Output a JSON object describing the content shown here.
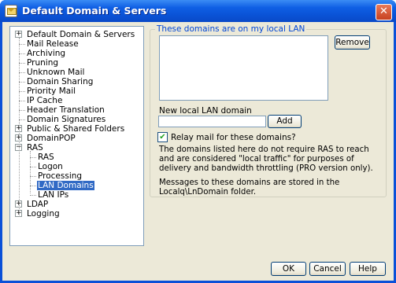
{
  "window": {
    "title": "Default Domain & Servers",
    "close_glyph": "✕"
  },
  "tree": {
    "items": [
      {
        "label": "Default Domain & Servers",
        "expander": "+"
      },
      {
        "label": "Mail Release"
      },
      {
        "label": "Archiving"
      },
      {
        "label": "Pruning"
      },
      {
        "label": "Unknown Mail"
      },
      {
        "label": "Domain Sharing"
      },
      {
        "label": "Priority Mail"
      },
      {
        "label": "IP Cache"
      },
      {
        "label": "Header Translation"
      },
      {
        "label": "Domain Signatures"
      },
      {
        "label": "Public & Shared Folders",
        "expander": "+"
      },
      {
        "label": "DomainPOP",
        "expander": "+"
      },
      {
        "label": "RAS",
        "expander": "−"
      },
      {
        "label": "RAS"
      },
      {
        "label": "Logon"
      },
      {
        "label": "Processing"
      },
      {
        "label": "LAN Domains",
        "selected": true
      },
      {
        "label": "LAN IPs"
      },
      {
        "label": "LDAP",
        "expander": "+"
      },
      {
        "label": "Logging",
        "expander": "+"
      }
    ]
  },
  "panel": {
    "group_title": "These domains are on my local LAN",
    "remove_label": "Remove",
    "new_domain_label": "New local LAN domain",
    "new_domain_value": "",
    "add_label": "Add",
    "relay_label": "Relay mail for these domains?",
    "relay_checked": true,
    "check_glyph": "✔",
    "info_text": "The domains listed here do not require RAS to reach and are considered \"local traffic\" for purposes of delivery and bandwidth throttling (PRO version only).",
    "stored_text": "Messages to these domains are stored in the Localq\\LnDomain folder."
  },
  "footer": {
    "ok_label": "OK",
    "cancel_label": "Cancel",
    "help_label": "Help"
  }
}
